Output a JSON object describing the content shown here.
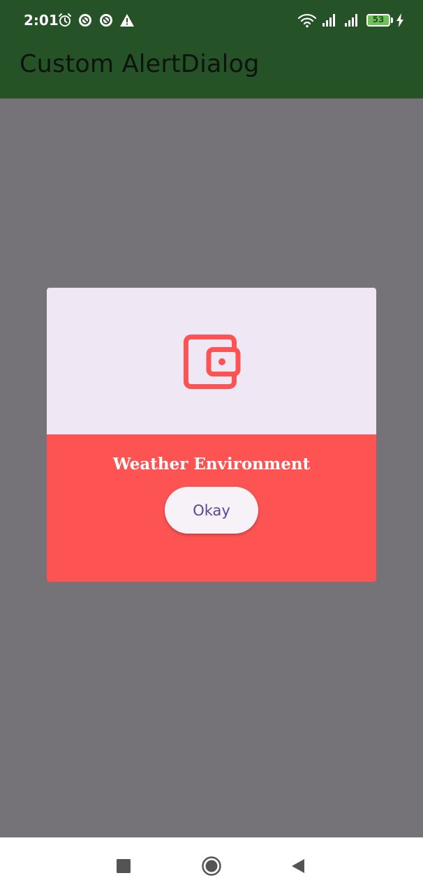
{
  "status_bar": {
    "time": "2:01",
    "battery": "53",
    "icons": [
      "alarm-icon",
      "sync-icon",
      "sync-icon",
      "warning-icon",
      "wifi-icon",
      "signal-icon",
      "signal-icon",
      "battery-icon",
      "charging-icon"
    ]
  },
  "app_bar": {
    "title": "Custom AlertDialog"
  },
  "dialog": {
    "icon": "wallet-icon",
    "title": "Weather Environment",
    "button_label": "Okay"
  },
  "colors": {
    "app_bar": "#265227",
    "scrim": "#757377",
    "dialog_top": "#efe7f3",
    "dialog_bottom": "#fe5353",
    "button_text": "#5d4396"
  },
  "nav_bar": {
    "buttons": [
      "recents-button",
      "home-button",
      "back-button"
    ]
  }
}
